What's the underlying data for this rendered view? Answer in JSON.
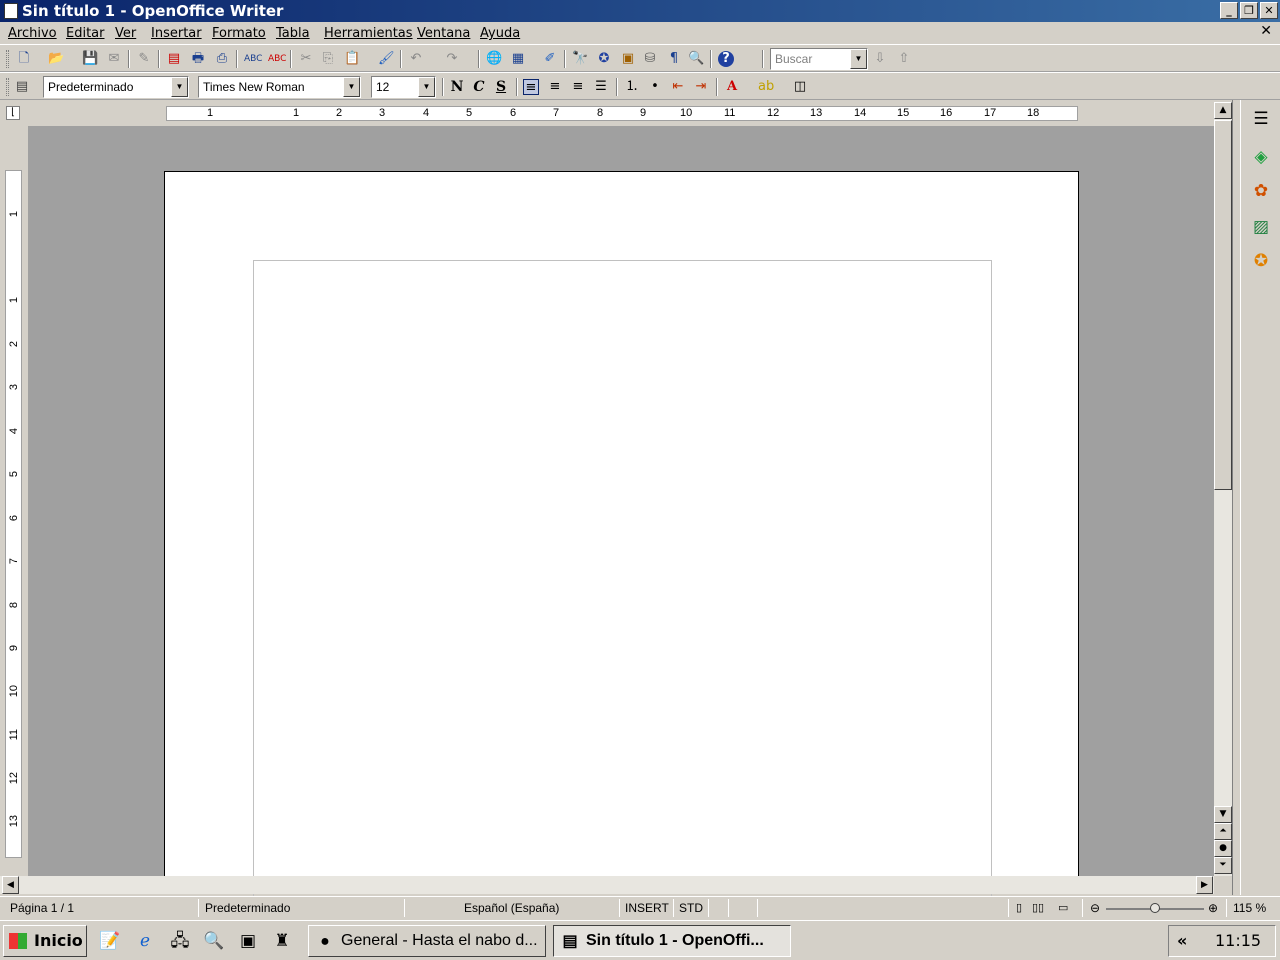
{
  "window": {
    "title": "Sin título 1 - OpenOffice Writer",
    "minimize": "_",
    "restore": "❐",
    "close": "✕",
    "doc_close": "✕"
  },
  "menu": [
    "Archivo",
    "Editar",
    "Ver",
    "Insertar",
    "Formato",
    "Tabla",
    "Herramientas",
    "Ventana",
    "Ayuda"
  ],
  "toolbar": {
    "search_placeholder": "Buscar"
  },
  "format_toolbar": {
    "style": "Predeterminado",
    "font": "Times New Roman",
    "size": "12",
    "bold": "N",
    "italic": "C",
    "underline": "S"
  },
  "ruler": {
    "h_ticks": [
      "1",
      "1",
      "2",
      "3",
      "4",
      "5",
      "6",
      "7",
      "8",
      "9",
      "10",
      "11",
      "12",
      "13",
      "14",
      "15",
      "16",
      "17",
      "18"
    ],
    "v_ticks": [
      "1",
      "1",
      "2",
      "3",
      "4",
      "5",
      "6",
      "7",
      "8",
      "9",
      "10",
      "11",
      "12",
      "13"
    ]
  },
  "statusbar": {
    "page": "Página  1 / 1",
    "style": "Predeterminado",
    "language": "Español (España)",
    "insert": "INSERT",
    "selection": "STD",
    "zoom": "115 %"
  },
  "taskbar": {
    "start": "Inicio",
    "tasks": [
      {
        "label": "General - Hasta el nabo d..."
      },
      {
        "label": "Sin título 1 - OpenOffi..."
      }
    ],
    "tray_arrow": "«",
    "clock": "11:15"
  }
}
